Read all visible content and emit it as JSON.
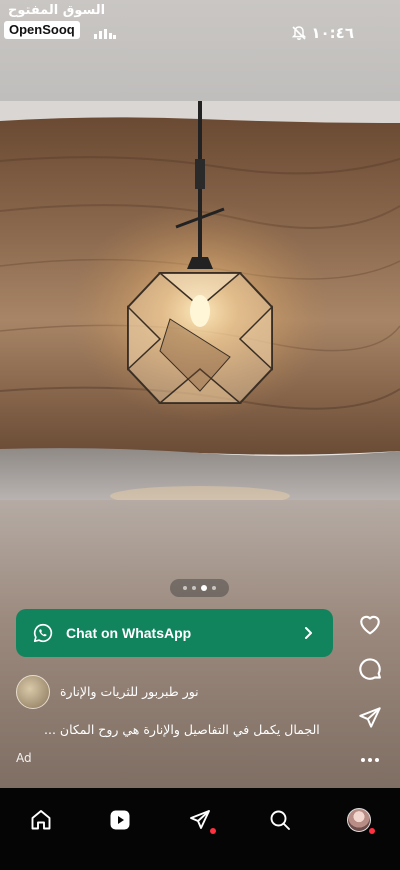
{
  "status_bar": {
    "brand_arabic": "السوق المفتوح",
    "brand": "OpenSooq",
    "time": "١٠:٤٦"
  },
  "media": {
    "page_dots": 4,
    "active_dot": 3
  },
  "cta": {
    "label": "Chat on WhatsApp",
    "color": "#12845d"
  },
  "post": {
    "account_name": "نور طبربور للثريات والإنارة",
    "caption": "الجمال يكمل في التفاصيل والإنارة هي روح المكان ...",
    "ad_label": "Ad"
  },
  "right_rail": {
    "icons": [
      "heart-icon",
      "comment-icon",
      "share-icon",
      "more-icon"
    ]
  },
  "bottom_nav": {
    "items": [
      "home-icon",
      "reels-icon",
      "messages-icon",
      "search-icon",
      "profile-avatar"
    ],
    "notification_color": "#ff3040"
  }
}
